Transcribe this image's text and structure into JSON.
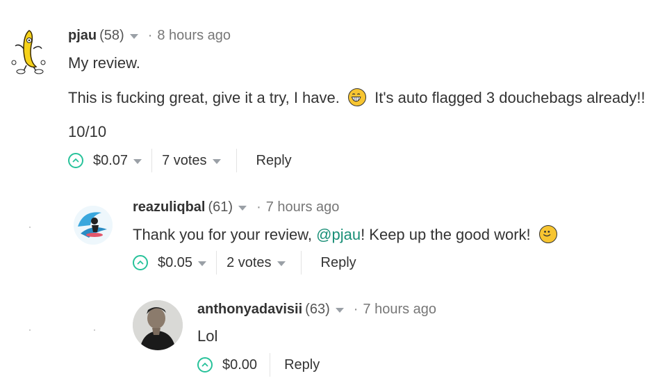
{
  "comments": [
    {
      "author": "pjau",
      "reputation": "(58)",
      "time": "8 hours ago",
      "lines": [
        "My review.",
        "This is fucking great, give it a try, I have.",
        "It's auto flagged 3 douchebags already!!",
        "10/10"
      ],
      "payout": "$0.07",
      "votes": "7 votes",
      "reply": "Reply",
      "avatar_icon": "dancing-banana-icon"
    },
    {
      "author": "reazuliqbal",
      "reputation": "(61)",
      "time": "7 hours ago",
      "text_before": "Thank you for your review, ",
      "mention": "@pjau",
      "text_after": "! Keep up the good work!",
      "payout": "$0.05",
      "votes": "2 votes",
      "reply": "Reply",
      "avatar_icon": "surfer-avatar-icon"
    },
    {
      "author": "anthonyadavisii",
      "reputation": "(63)",
      "time": "7 hours ago",
      "text": "Lol",
      "payout": "$0.00",
      "reply": "Reply",
      "avatar_icon": "person-photo-avatar"
    }
  ],
  "separator_dot": "·",
  "colors": {
    "accent": "#27c29a",
    "mention": "#1a8f77"
  }
}
